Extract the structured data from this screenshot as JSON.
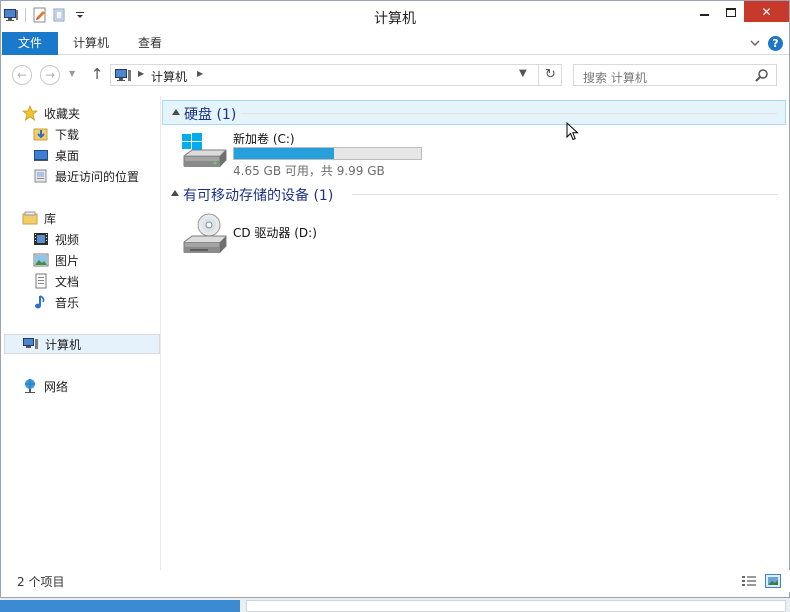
{
  "window": {
    "title": "计算机",
    "close_glyph": "✕"
  },
  "ribbon": {
    "tabs": [
      "文件",
      "计算机",
      "查看"
    ],
    "help_glyph": "?"
  },
  "navigation": {
    "back_glyph": "←",
    "forward_glyph": "→",
    "up_glyph": "↑",
    "address_crumb": "计算机",
    "refresh_glyph": "↻",
    "search_placeholder": "搜索 计算机"
  },
  "sidebar": {
    "favorites": {
      "label": "收藏夹",
      "icon": "star-icon"
    },
    "favorites_items": [
      {
        "label": "下载",
        "icon": "downloads-icon"
      },
      {
        "label": "桌面",
        "icon": "desktop-icon"
      },
      {
        "label": "最近访问的位置",
        "icon": "recent-places-icon"
      }
    ],
    "libraries": {
      "label": "库",
      "icon": "library-icon"
    },
    "library_items": [
      {
        "label": "视频",
        "icon": "video-icon"
      },
      {
        "label": "图片",
        "icon": "pictures-icon"
      },
      {
        "label": "文档",
        "icon": "documents-icon"
      },
      {
        "label": "音乐",
        "icon": "music-icon"
      }
    ],
    "computer": {
      "label": "计算机",
      "icon": "computer-icon",
      "selected": true
    },
    "network": {
      "label": "网络",
      "icon": "network-icon"
    }
  },
  "content": {
    "groups": [
      {
        "title": "硬盘 (1)",
        "items": [
          {
            "name": "新加卷 (C:)",
            "size_text": "4.65 GB 可用，共 9.99 GB",
            "used_fraction": 0.535,
            "icon": "hard-drive-icon"
          }
        ]
      },
      {
        "title": "有可移动存储的设备 (1)",
        "items": [
          {
            "name": "CD 驱动器 (D:)",
            "icon": "cd-drive-icon"
          }
        ]
      }
    ]
  },
  "status": {
    "item_count": "2 个项目"
  },
  "colors": {
    "accent": "#1979ca",
    "group_title": "#1e3287",
    "usage_bar": "#26a0da",
    "close_button": "#c7392b",
    "selection": "#e5f1fb"
  }
}
